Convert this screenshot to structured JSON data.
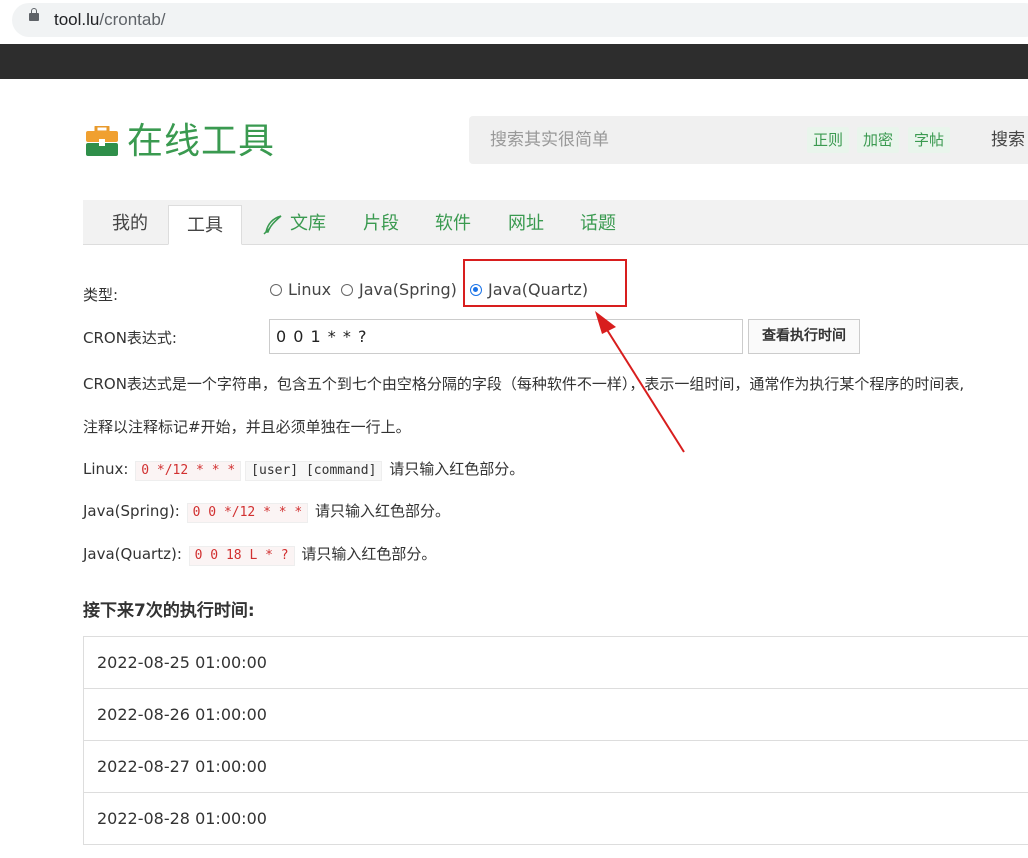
{
  "browser": {
    "url_host": "tool.lu",
    "url_path": "/crontab/"
  },
  "header": {
    "logo_text": "在线工具",
    "search_placeholder": "搜索其实很简单",
    "tags": [
      "正则",
      "加密",
      "字帖"
    ],
    "search_button": "搜索"
  },
  "tabs": {
    "items": [
      "我的",
      "工具",
      "文库",
      "片段",
      "软件",
      "网址",
      "话题"
    ],
    "active": "工具"
  },
  "form": {
    "type_label": "类型:",
    "options": [
      "Linux",
      "Java(Spring)",
      "Java(Quartz)"
    ],
    "selected": "Java(Quartz)",
    "cron_label": "CRON表达式:",
    "cron_value": "0 0 1 * * ?",
    "run_button": "查看执行时间"
  },
  "description": {
    "line1": "CRON表达式是一个字符串，包含五个到七个由空格分隔的字段（每种软件不一样），表示一组时间，通常作为执行某个程序的时间表,",
    "line2": "注释以注释标记#开始，并且必须单独在一行上。",
    "examples": [
      {
        "label": "Linux:",
        "code": "0 */12 * * *",
        "extra": "[user] [command]",
        "note": "请只输入红色部分。"
      },
      {
        "label": "Java(Spring):",
        "code": "0 0 */12 * * *",
        "note": "请只输入红色部分。"
      },
      {
        "label": "Java(Quartz):",
        "code": "0 0 18 L * ?",
        "note": "请只输入红色部分。"
      }
    ]
  },
  "results": {
    "heading": "接下来7次的执行时间:",
    "times": [
      "2022-08-25 01:00:00",
      "2022-08-26 01:00:00",
      "2022-08-27 01:00:00",
      "2022-08-28 01:00:00"
    ]
  },
  "colors": {
    "brand_green": "#3a9a50",
    "annotation_red": "#d81e1e",
    "radio_blue": "#1a73e8"
  }
}
